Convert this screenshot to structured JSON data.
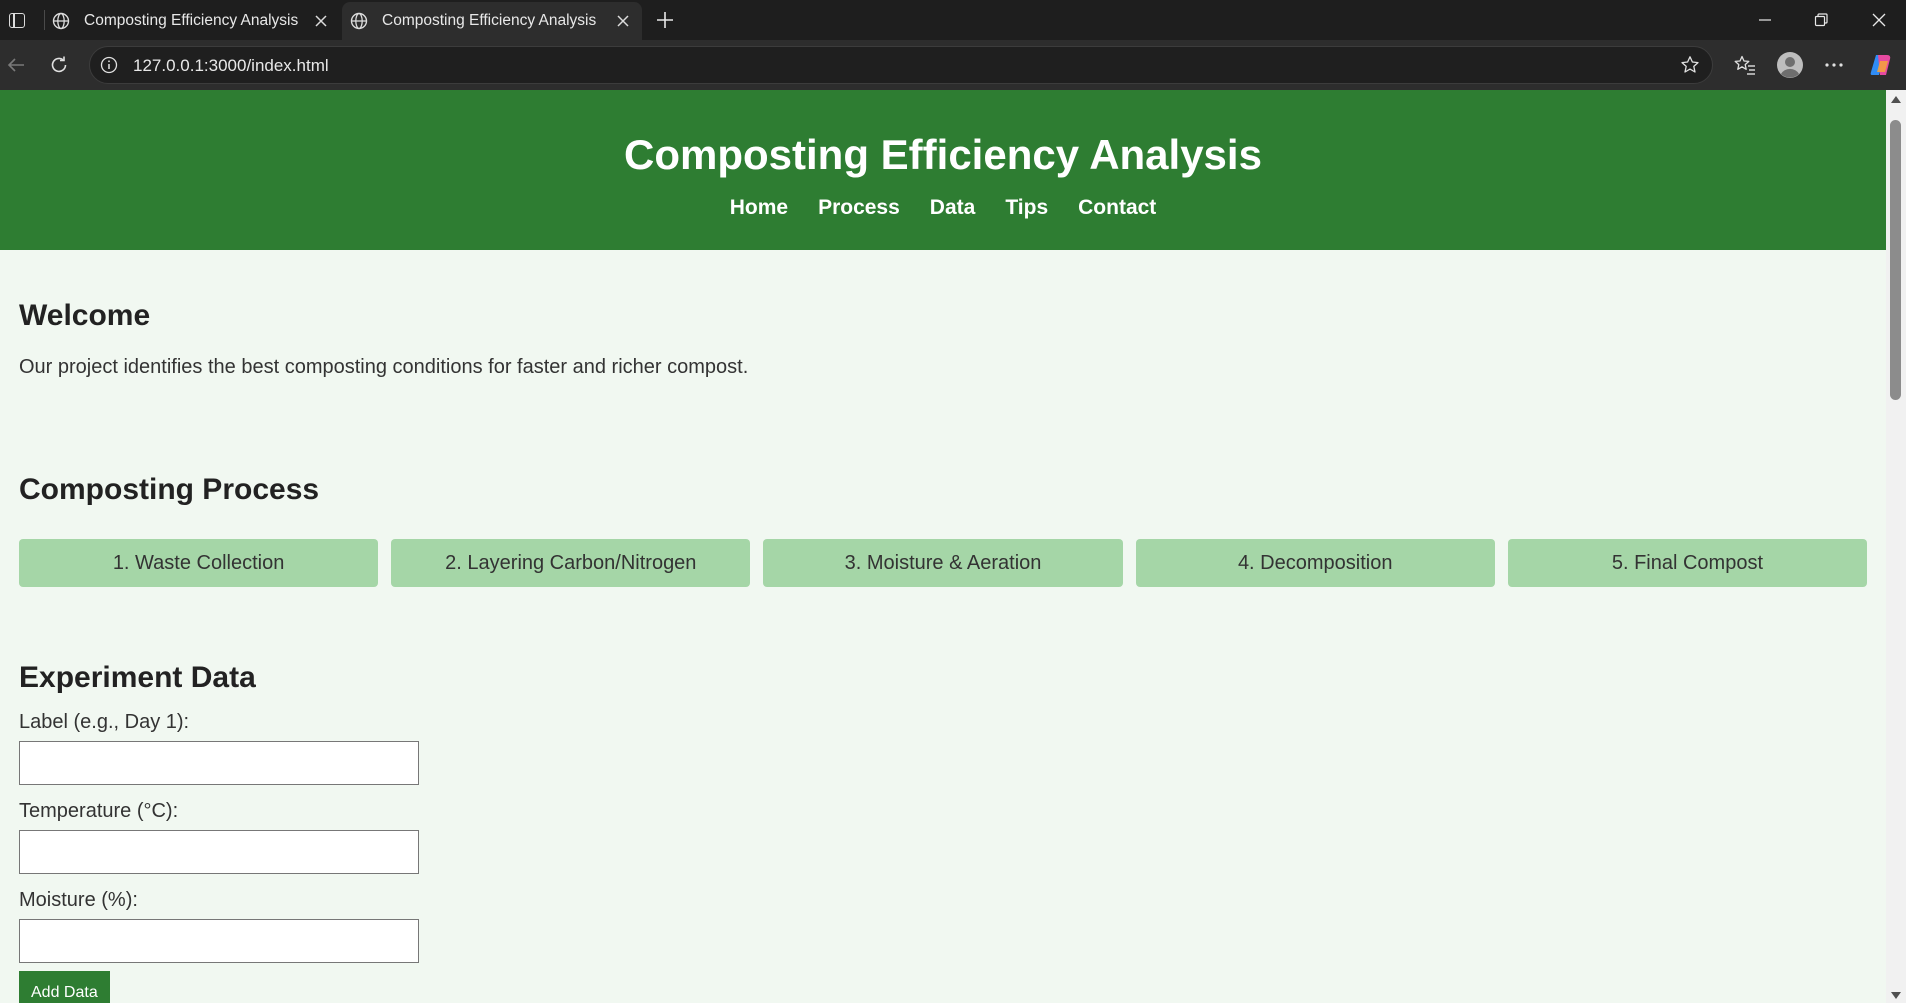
{
  "browser": {
    "tabs": [
      {
        "title": "Composting Efficiency Analysis",
        "active": false
      },
      {
        "title": "Composting Efficiency Analysis",
        "active": true
      }
    ],
    "url": "127.0.0.1:3000/index.html"
  },
  "header": {
    "title": "Composting Efficiency Analysis",
    "nav": [
      "Home",
      "Process",
      "Data",
      "Tips",
      "Contact"
    ]
  },
  "welcome": {
    "title": "Welcome",
    "text": "Our project identifies the best composting conditions for faster and richer compost."
  },
  "process": {
    "title": "Composting Process",
    "steps": [
      "1. Waste Collection",
      "2. Layering Carbon/Nitrogen",
      "3. Moisture & Aeration",
      "4. Decomposition",
      "5. Final Compost"
    ]
  },
  "experiment": {
    "title": "Experiment Data",
    "label_field": {
      "label": "Label (e.g., Day 1):",
      "value": ""
    },
    "temperature_field": {
      "label": "Temperature (°C):",
      "value": ""
    },
    "moisture_field": {
      "label": "Moisture (%):",
      "value": ""
    },
    "add_button": "Add Data"
  },
  "colors": {
    "header_bg": "#2e7d32",
    "step_bg": "#a5d6a7",
    "page_bg": "#f1f8f1"
  }
}
